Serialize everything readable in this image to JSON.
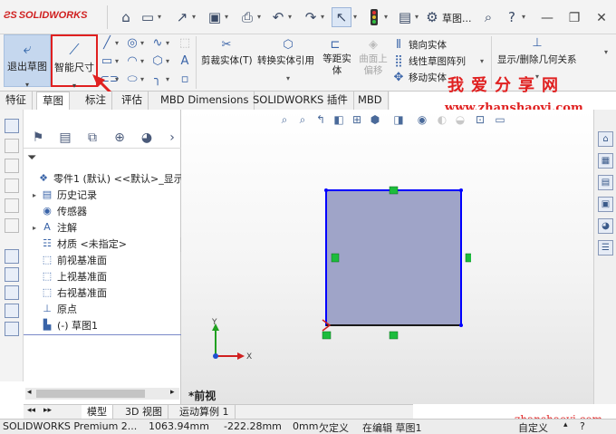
{
  "app": {
    "brand": "SOLIDWORKS",
    "document_name": "草图..."
  },
  "titlebar": {
    "icons": [
      "home-icon",
      "new-document-icon",
      "open-icon",
      "save-icon",
      "print-icon",
      "undo-icon",
      "redo-icon",
      "select-icon",
      "traffic-light-icon",
      "options-icon"
    ],
    "window_controls": [
      "search-icon",
      "help-icon",
      "minimize-icon",
      "maximize-icon",
      "close-icon"
    ]
  },
  "ribbon": {
    "exit_sketch_label": "退出草图",
    "smart_dimension_label": "智能尺寸",
    "trim_label": "剪裁实体(T)",
    "convert_label": "转换实体引用",
    "offset_label": "等距实体",
    "offset_surface_label": "曲面上偏移",
    "mirror_label": "镜向实体",
    "linear_pattern_label": "线性草图阵列",
    "move_label": "移动实体",
    "relations_label": "显示/删除几何关系"
  },
  "tabs": [
    "特征",
    "草图",
    "标注",
    "评估",
    "MBD Dimensions",
    "SOLIDWORKS 插件",
    "MBD"
  ],
  "active_tab": "草图",
  "watermark": {
    "chinese": "我爱分享网",
    "url": "www.zhanshaoyi.com",
    "url_bottom": "zhanshaoyi.com"
  },
  "feature_tree": {
    "filter_icon": "filter-icon",
    "items": [
      {
        "label": "零件1 (默认) <<默认>_显示状",
        "icon": "part-icon",
        "expand": ""
      },
      {
        "label": "历史记录",
        "icon": "history-icon",
        "expand": "▸"
      },
      {
        "label": "传感器",
        "icon": "sensor-icon",
        "expand": ""
      },
      {
        "label": "注解",
        "icon": "annotation-icon",
        "expand": "▸"
      },
      {
        "label": "材质 <未指定>",
        "icon": "material-icon",
        "expand": ""
      },
      {
        "label": "前视基准面",
        "icon": "plane-icon",
        "expand": ""
      },
      {
        "label": "上视基准面",
        "icon": "plane-icon",
        "expand": ""
      },
      {
        "label": "右视基准面",
        "icon": "plane-icon",
        "expand": ""
      },
      {
        "label": "原点",
        "icon": "origin-icon",
        "expand": ""
      },
      {
        "label": "(-) 草图1",
        "icon": "sketch-icon",
        "expand": ""
      }
    ]
  },
  "graphics": {
    "view_label": "*前视",
    "axis_x": "X",
    "axis_y": "Y"
  },
  "bottom_tabs": [
    "模型",
    "3D 视图",
    "运动算例 1"
  ],
  "active_bottom_tab": "模型",
  "statusbar": {
    "product": "SOLIDWORKS Premium 2...",
    "x": "1063.94mm",
    "y": "-222.28mm",
    "z": "0mm",
    "state": "欠定义",
    "editing": "在编辑 草图1",
    "units": "自定义"
  }
}
